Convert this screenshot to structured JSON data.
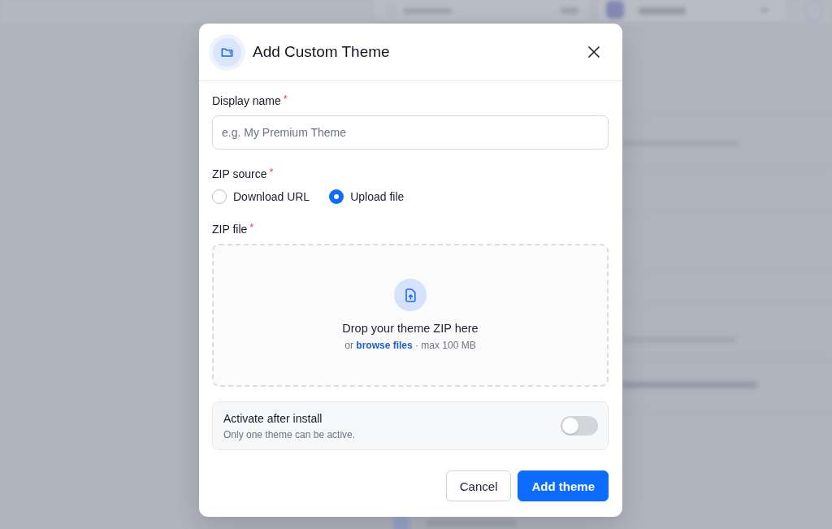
{
  "dialog": {
    "title": "Add Custom Theme",
    "fields": [
      {
        "kind": "text",
        "label": "Display name",
        "required_mark": "*",
        "placeholder": "e.g. My Premium Theme"
      },
      {
        "kind": "radio",
        "label": "ZIP source",
        "required_mark": "*",
        "options": [
          {
            "label": "Download URL",
            "selected": false
          },
          {
            "label": "Upload file",
            "selected": true
          }
        ]
      },
      {
        "kind": "dropzone",
        "label": "ZIP file",
        "required_mark": "*",
        "heading": "Drop your theme ZIP here",
        "hint_before": "or",
        "link": "browse files",
        "hint_after": "· max 100 MB"
      }
    ],
    "activate": {
      "title": "Activate after install",
      "description": "Only one theme can be active.",
      "on": false
    },
    "buttons": [
      {
        "kind": "cancel",
        "label": "Cancel"
      },
      {
        "kind": "submit",
        "label": "Add theme"
      }
    ]
  }
}
